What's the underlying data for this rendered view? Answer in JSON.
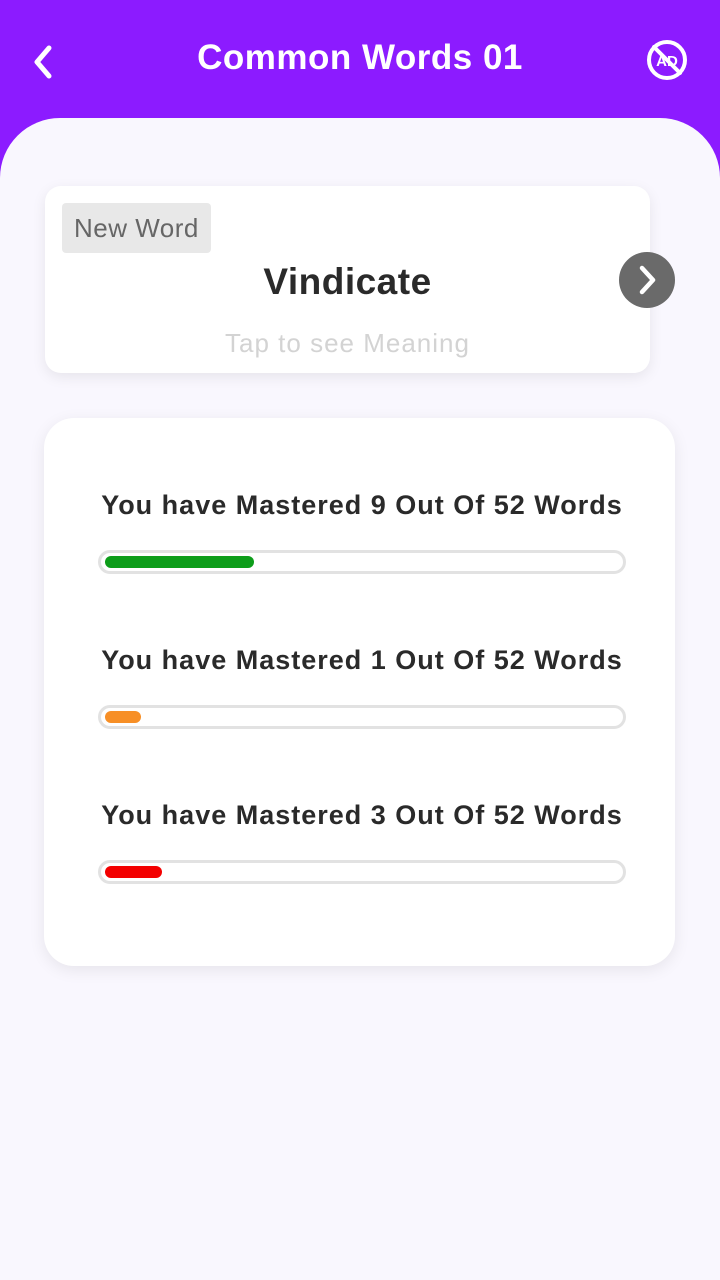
{
  "header": {
    "title": "Common Words 01",
    "back_icon": "chevron-left-icon",
    "no_ads_icon": "no-ads-icon",
    "no_ads_text": "AD",
    "background": "#8c1bff"
  },
  "word_card": {
    "badge": "New Word",
    "word": "Vindicate",
    "hint": "Tap to see Meaning",
    "next_icon": "chevron-right-icon"
  },
  "progress": [
    {
      "label": "You have Mastered 9 Out Of 52 Words",
      "mastered": 9,
      "total": 52,
      "fill_fraction": 0.29,
      "color": "#0d9d1a"
    },
    {
      "label": "You have Mastered 1 Out Of 52 Words",
      "mastered": 1,
      "total": 52,
      "fill_fraction": 0.07,
      "color": "#f78f26"
    },
    {
      "label": "You have Mastered 3 Out Of 52 Words",
      "mastered": 3,
      "total": 52,
      "fill_fraction": 0.11,
      "color": "#f30000"
    }
  ]
}
